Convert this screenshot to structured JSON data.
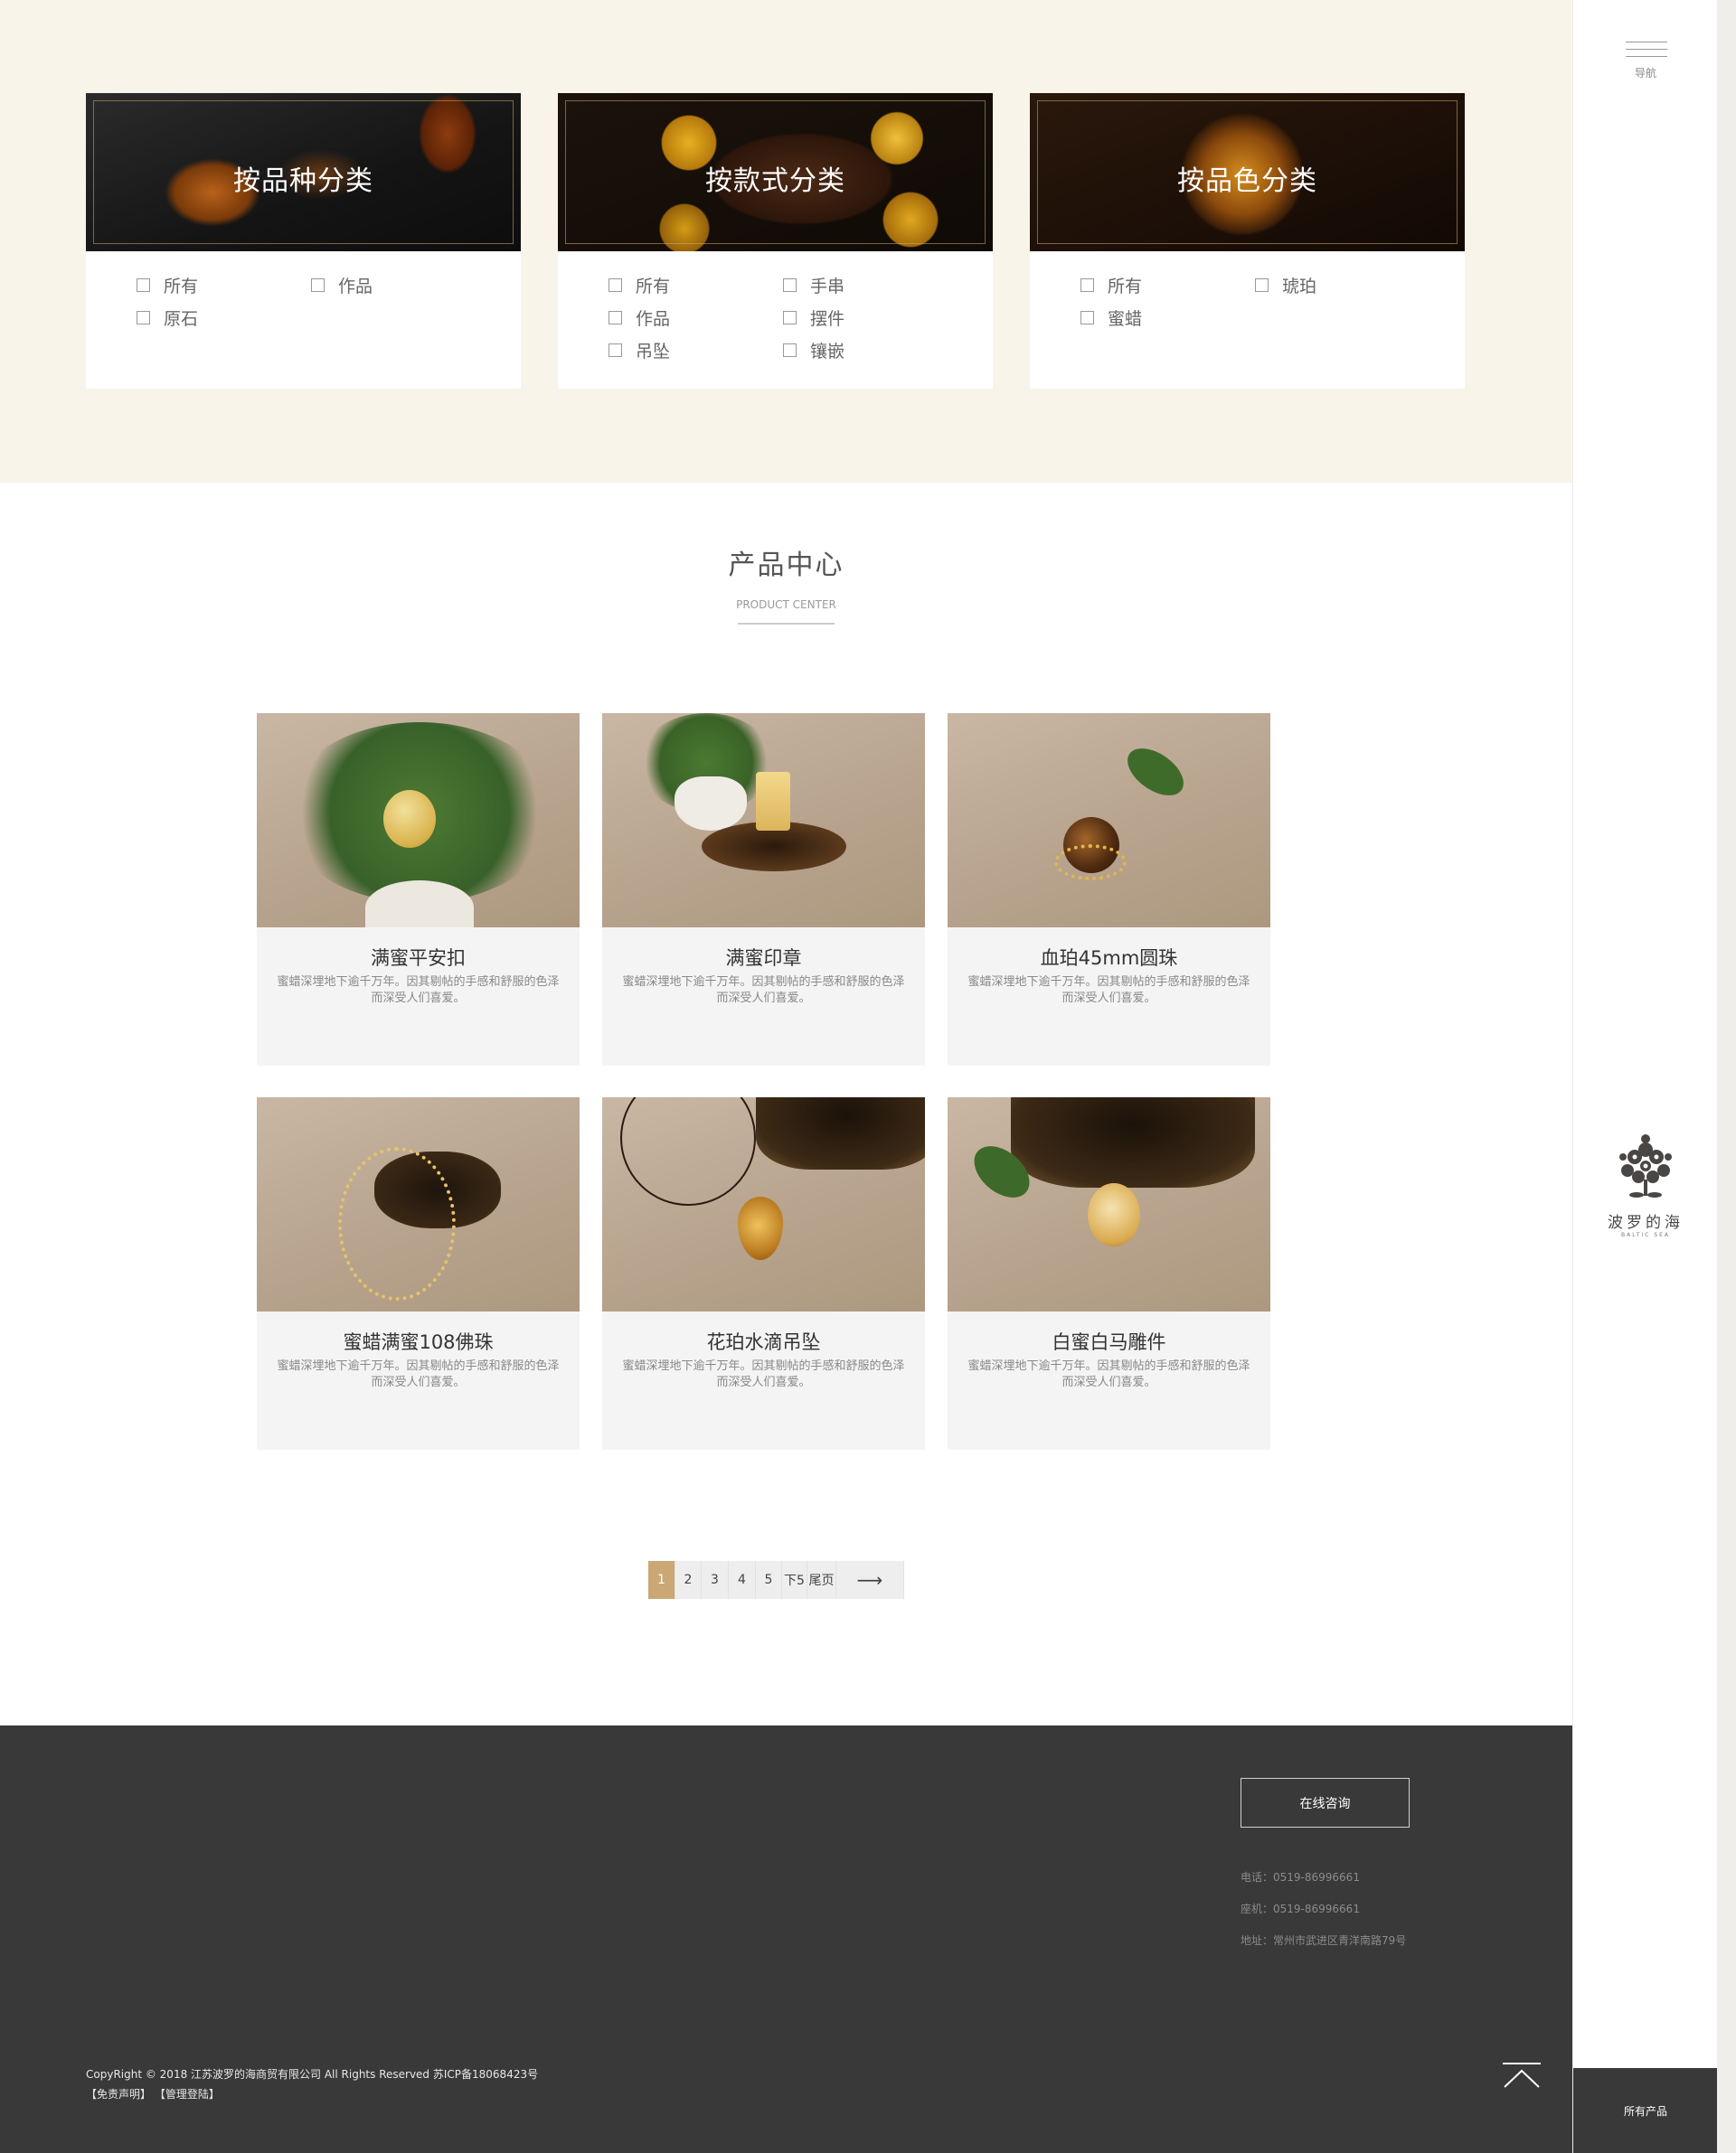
{
  "categories": [
    {
      "title": "按品种分类",
      "options": [
        "所有",
        "作品",
        "原石"
      ]
    },
    {
      "title": "按款式分类",
      "options": [
        "所有",
        "手串",
        "作品",
        "摆件",
        "吊坠",
        "镶嵌"
      ]
    },
    {
      "title": "按品色分类",
      "options": [
        "所有",
        "琥珀",
        "蜜蜡"
      ]
    }
  ],
  "section": {
    "title": "产品中心",
    "subtitle": "PRODUCT CENTER"
  },
  "products": [
    {
      "name": "满蜜平安扣",
      "desc": "蜜蜡深埋地下逾千万年。因其剔帖的手感和舒服的色泽而深受人们喜爱。"
    },
    {
      "name": "满蜜印章",
      "desc": "蜜蜡深埋地下逾千万年。因其剔帖的手感和舒服的色泽而深受人们喜爱。"
    },
    {
      "name": "血珀45mm圆珠",
      "desc": "蜜蜡深埋地下逾千万年。因其剔帖的手感和舒服的色泽而深受人们喜爱。"
    },
    {
      "name": "蜜蜡满蜜108佛珠",
      "desc": "蜜蜡深埋地下逾千万年。因其剔帖的手感和舒服的色泽而深受人们喜爱。"
    },
    {
      "name": "花珀水滴吊坠",
      "desc": "蜜蜡深埋地下逾千万年。因其剔帖的手感和舒服的色泽而深受人们喜爱。"
    },
    {
      "name": "白蜜白马雕件",
      "desc": "蜜蜡深埋地下逾千万年。因其剔帖的手感和舒服的色泽而深受人们喜爱。"
    }
  ],
  "pagination": {
    "pages": [
      "1",
      "2",
      "3",
      "4",
      "5"
    ],
    "next_label": "下5",
    "last_label": "尾页",
    "arrow": "⟶"
  },
  "footer": {
    "consult_label": "在线咨询",
    "phone": "电话：0519-86996661",
    "landline": "座机：0519-86996661",
    "address": "地址：常州市武进区青洋南路79号",
    "copyright": "CopyRight © 2018 江苏波罗的海商贸有限公司 All Rights Reserved 苏ICP备18068423号",
    "disclaimer": "【免责声明】",
    "admin_login": "【管理登陆】"
  },
  "sidebar": {
    "nav_label": "导航",
    "brand_name": "波罗的海",
    "brand_en": "BALTIC SEA",
    "all_products": "所有产品"
  },
  "colors": {
    "band": "#f8f4ea",
    "accent": "#caa774",
    "footer": "#3a3939"
  }
}
